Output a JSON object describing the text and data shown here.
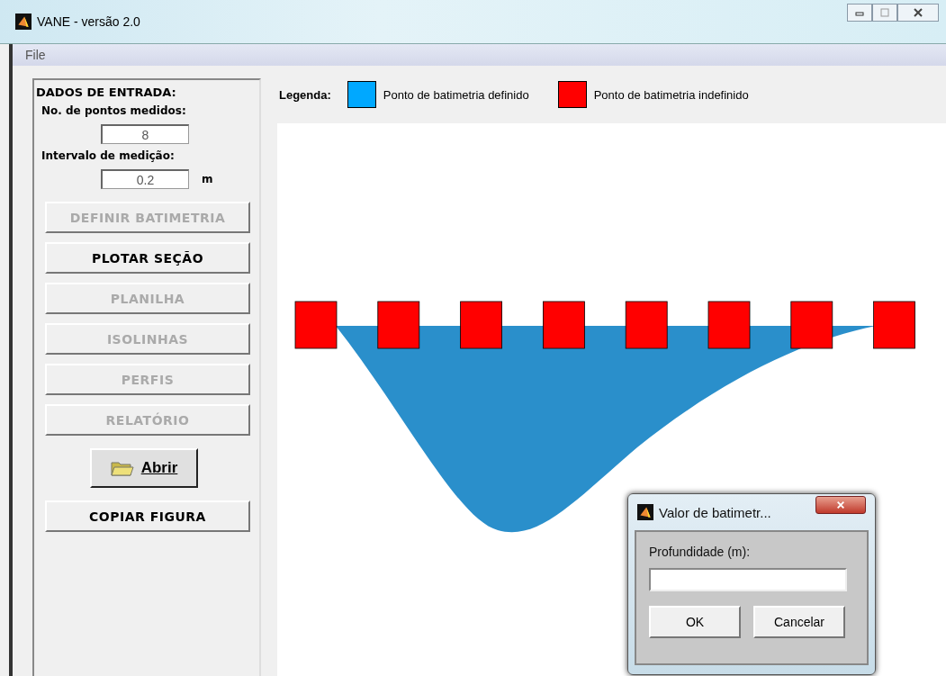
{
  "window": {
    "title": "VANE - versão 2.0"
  },
  "menu": [
    "File"
  ],
  "input_panel": {
    "heading": "DADOS DE ENTRADA:",
    "fields": [
      {
        "label": "No. de pontos medidos:",
        "value": "8"
      },
      {
        "label": "Intervalo de medição:",
        "value": "0.2",
        "unit": "m"
      }
    ],
    "buttons": [
      {
        "kind": "text",
        "label": "DEFINIR BATIMETRIA",
        "disabled": true
      },
      {
        "kind": "text",
        "label": "PLOTAR SEÇÃO",
        "disabled": false
      },
      {
        "kind": "text",
        "label": "PLANILHA",
        "disabled": true
      },
      {
        "kind": "text",
        "label": "ISOLINHAS",
        "disabled": true
      },
      {
        "kind": "text",
        "label": "PERFIS",
        "disabled": true
      },
      {
        "kind": "text",
        "label": "RELATÓRIO",
        "disabled": true
      },
      {
        "kind": "icon",
        "label": "Abrir",
        "disabled": false
      },
      {
        "kind": "text",
        "label": "COPIAR FIGURA",
        "disabled": false
      }
    ]
  },
  "legend": {
    "title": "Legenda:",
    "items": [
      {
        "label": "Ponto de batimetria definido",
        "color": "#00a8ff"
      },
      {
        "label": "Ponto de batimetria indefinido",
        "color": "#ff0000"
      }
    ]
  },
  "points": [
    {
      "defined": false
    },
    {
      "defined": false
    },
    {
      "defined": false
    },
    {
      "defined": false
    },
    {
      "defined": false
    },
    {
      "defined": false
    },
    {
      "defined": false
    },
    {
      "defined": false
    }
  ],
  "dialog": {
    "title": "Valor de batimetr...",
    "label": "Profundidade (m):",
    "buttons": [
      "OK",
      "Cancelar"
    ]
  }
}
